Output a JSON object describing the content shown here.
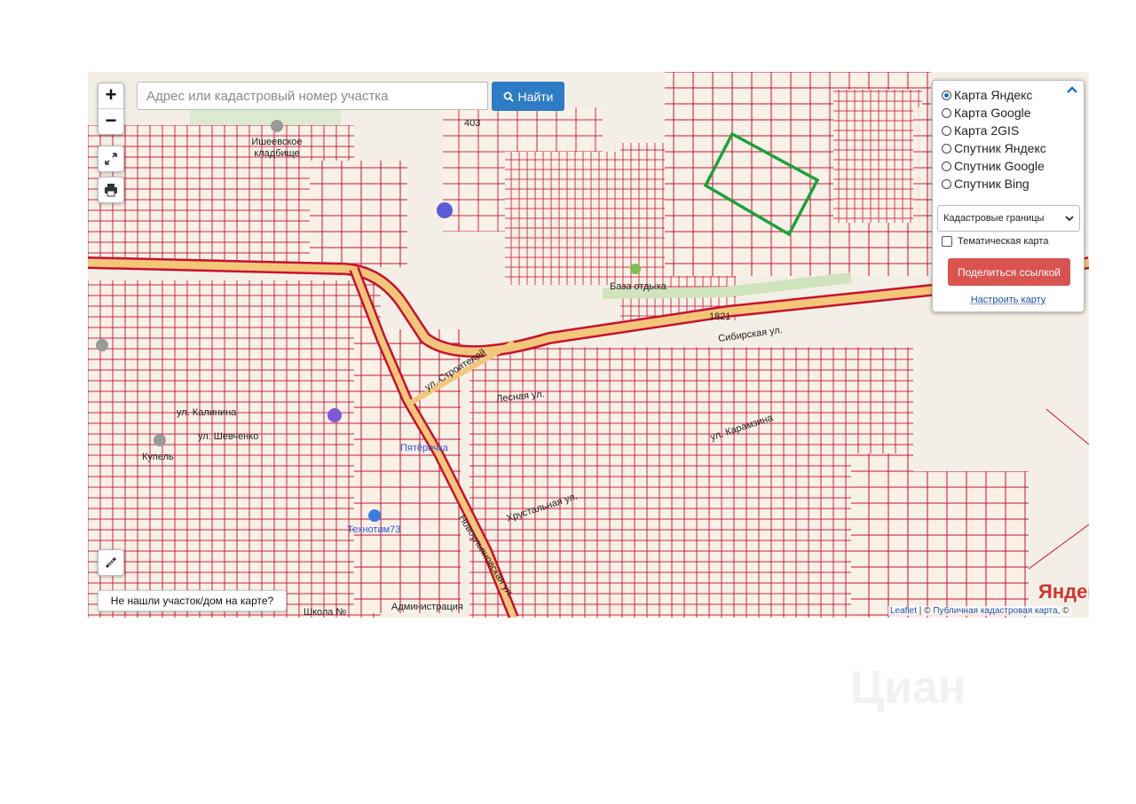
{
  "search": {
    "placeholder": "Адрес или кадастровый номер участка",
    "button_label": "Найти"
  },
  "zoom": {
    "in_label": "+",
    "out_label": "−"
  },
  "layers": {
    "options": [
      "Карта Яндекс",
      "Карта Google",
      "Карта 2GIS",
      "Спутник Яндекс",
      "Спутник Google",
      "Спутник Bing"
    ],
    "selected_index": 0
  },
  "overlay_select": {
    "value": "Кадастровые границы"
  },
  "thematic_checkbox": {
    "label": "Тематическая карта",
    "checked": false
  },
  "share_button": {
    "label": "Поделиться ссылкой"
  },
  "configure_link": {
    "label": "Настроить карту"
  },
  "not_found_button": {
    "label": "Не нашли участок/дом на карте?"
  },
  "attribution": {
    "leaflet": "Leaflet",
    "sep": " | © ",
    "cadastre": "Публичная кадастровая карта",
    "tail": ", ©"
  },
  "yandex_logo": "Яндекс",
  "watermark": "Циан",
  "map_labels": {
    "cemetery": "Ишеевское кладбище",
    "street_stroiteley": "ул. Строителей",
    "street_sibirskaya": "Сибирская ул.",
    "street_lesnaya": "Лесная ул.",
    "street_kalinina": "ул. Калинина",
    "street_shevchenko": "ул. Шевченко",
    "street_novoulyanovskaya": "Новоульяновская ул.",
    "street_khrustalnaya": "Хрустальная ул.",
    "street_karamzina": "ул. Карамзина",
    "base": "База отдыха",
    "kupel": "Купель",
    "technotim": "Технотим73",
    "pyaterochka": "Пятёрочка",
    "school": "Школа №",
    "administration": "Администрация",
    "plot_1821": "1821",
    "plot_403": "403"
  },
  "colors": {
    "parcel": "#c8102e",
    "selection": "#1aa33a",
    "road": "#f3c77a",
    "accent": "#2e7cc5",
    "share": "#d9534f"
  }
}
